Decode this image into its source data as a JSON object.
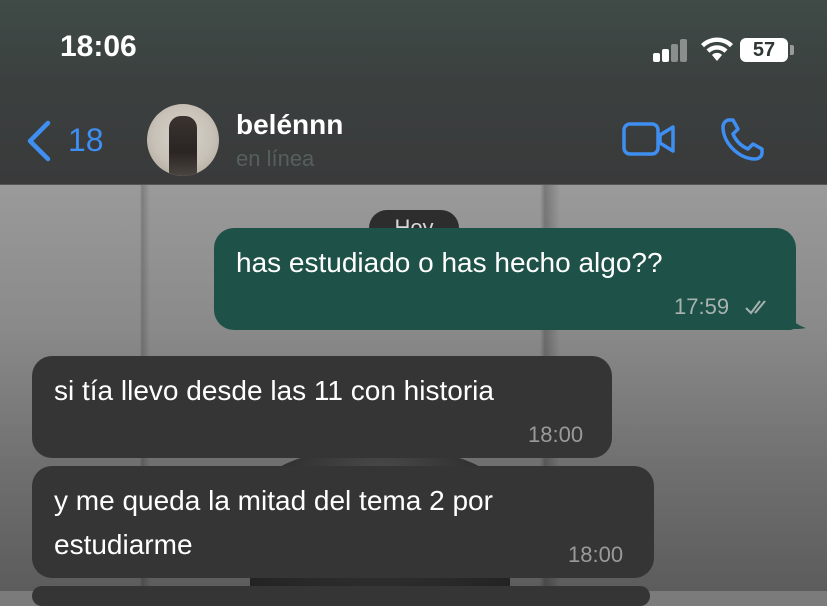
{
  "status_bar": {
    "time": "18:06",
    "battery": "57"
  },
  "header": {
    "back_count": "18",
    "contact_name": "belénnn",
    "contact_status": "en línea"
  },
  "chat": {
    "date_label": "Hoy",
    "messages": [
      {
        "direction": "outgoing",
        "text": "has estudiado o has hecho algo??",
        "time": "17:59",
        "status": "read"
      },
      {
        "direction": "incoming",
        "text": "si tía llevo desde las 11 con historia",
        "time": "18:00"
      },
      {
        "direction": "incoming",
        "text_line1": "y me queda la mitad del tema 2 por",
        "text_line2": "estudiarme",
        "time": "18:00"
      }
    ]
  },
  "colors": {
    "accent": "#3f8ef2",
    "outgoing_bubble": "#1e5147",
    "incoming_bubble": "#353535"
  }
}
